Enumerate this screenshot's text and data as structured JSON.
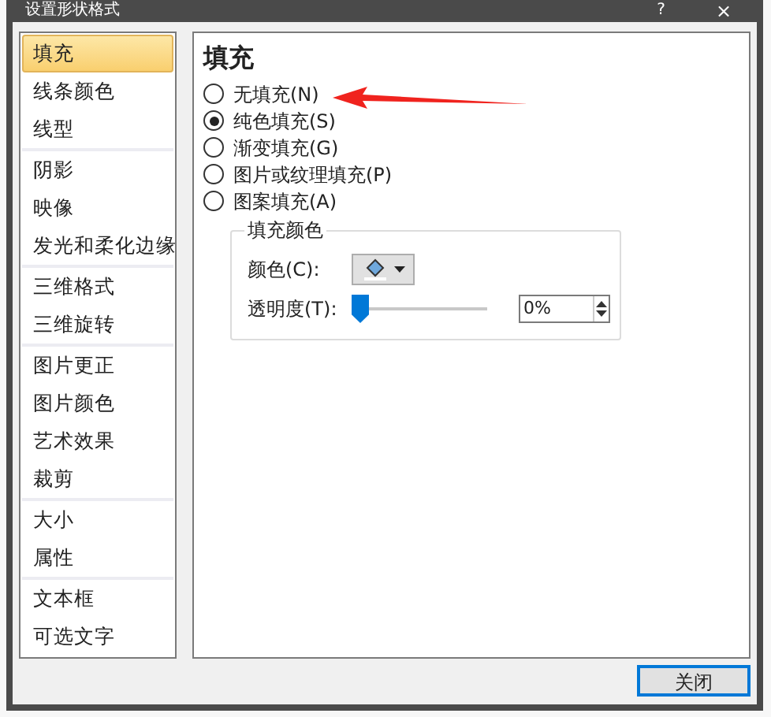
{
  "window": {
    "title": "设置形状格式",
    "help": "?",
    "close": "×"
  },
  "sidebar": {
    "groups": [
      {
        "items": [
          {
            "label": "填充",
            "selected": true
          },
          {
            "label": "线条颜色",
            "selected": false
          },
          {
            "label": "线型",
            "selected": false
          }
        ]
      },
      {
        "items": [
          {
            "label": "阴影",
            "selected": false
          },
          {
            "label": "映像",
            "selected": false
          },
          {
            "label": "发光和柔化边缘",
            "selected": false
          }
        ]
      },
      {
        "items": [
          {
            "label": "三维格式",
            "selected": false
          },
          {
            "label": "三维旋转",
            "selected": false
          }
        ]
      },
      {
        "items": [
          {
            "label": "图片更正",
            "selected": false
          },
          {
            "label": "图片颜色",
            "selected": false
          },
          {
            "label": "艺术效果",
            "selected": false
          },
          {
            "label": "裁剪",
            "selected": false
          }
        ]
      },
      {
        "items": [
          {
            "label": "大小",
            "selected": false
          },
          {
            "label": "属性",
            "selected": false
          }
        ]
      },
      {
        "items": [
          {
            "label": "文本框",
            "selected": false
          },
          {
            "label": "可选文字",
            "selected": false
          }
        ]
      }
    ]
  },
  "panel": {
    "heading": "填充",
    "options": [
      {
        "label": "无填充(N)",
        "selected": false
      },
      {
        "label": "纯色填充(S)",
        "selected": true
      },
      {
        "label": "渐变填充(G)",
        "selected": false
      },
      {
        "label": "图片或纹理填充(P)",
        "selected": false
      },
      {
        "label": "图案填充(A)",
        "selected": false
      }
    ],
    "fill_color": {
      "title": "填充颜色",
      "color_label": "颜色(C):",
      "transparency_label": "透明度(T):",
      "transparency": {
        "level": 0
      },
      "transparency_value": "0%"
    }
  },
  "buttons": [
    "关闭"
  ]
}
